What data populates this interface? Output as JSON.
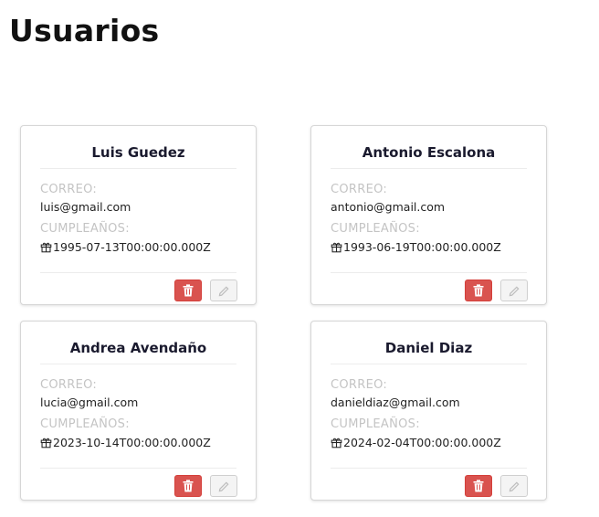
{
  "page": {
    "title": "Usuarios"
  },
  "labels": {
    "email": "CORREO:",
    "birthday": "CUMPLEAÑOS:"
  },
  "colors": {
    "delete_button": "#d9534f",
    "edit_button": "#f4f4f4",
    "label": "#c4c4c4"
  },
  "icons": {
    "delete": "trash-icon",
    "edit": "pencil-icon",
    "birthday": "gift-icon"
  },
  "users": [
    {
      "name": "Luis Guedez",
      "email": "luis@gmail.com",
      "birthday": "1995-07-13T00:00:00.000Z"
    },
    {
      "name": "Antonio Escalona",
      "email": "antonio@gmail.com",
      "birthday": "1993-06-19T00:00:00.000Z"
    },
    {
      "name": "Andrea Avendaño",
      "email": "lucia@gmail.com",
      "birthday": "2023-10-14T00:00:00.000Z"
    },
    {
      "name": "Daniel Diaz",
      "email": "danieldiaz@gmail.com",
      "birthday": "2024-02-04T00:00:00.000Z"
    }
  ]
}
